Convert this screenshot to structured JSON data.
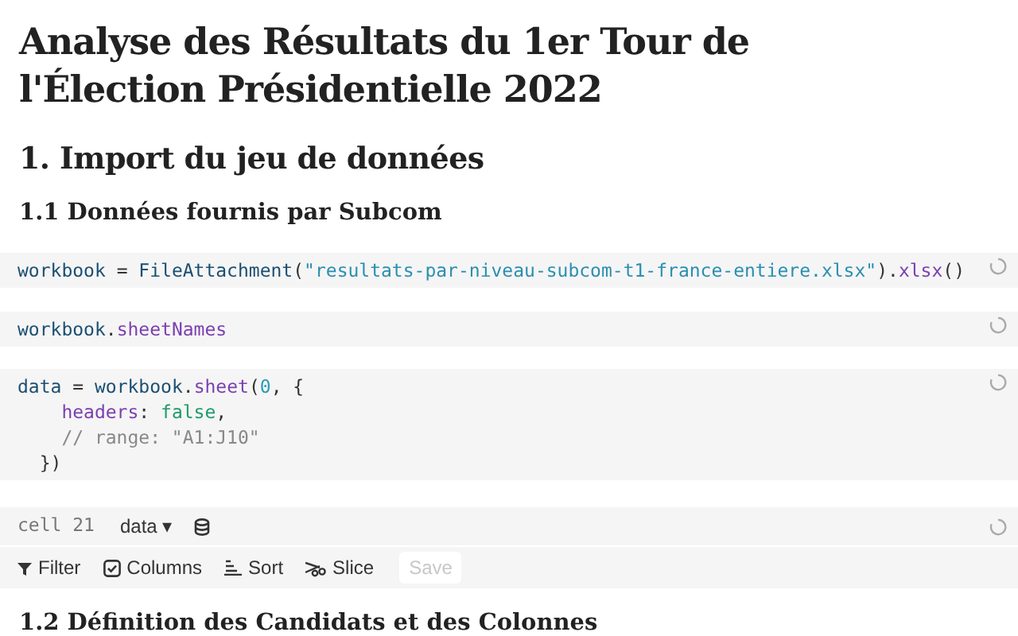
{
  "title": "Analyse des Résultats du 1er Tour de l'Élection Présidentielle 2022",
  "heading_1": "1. Import du jeu de données",
  "heading_2": "1.1 Données fournis par Subcom",
  "cells": [
    {
      "lines": [
        [
          {
            "t": "workbook",
            "kind": "var"
          },
          {
            "t": " = ",
            "kind": "op"
          },
          {
            "t": "FileAttachment",
            "kind": "var"
          },
          {
            "t": "(",
            "kind": "op"
          },
          {
            "t": "\"resultats-par-niveau-subcom-t1-france-entiere.xlsx\"",
            "kind": "str"
          },
          {
            "t": ").",
            "kind": "op"
          },
          {
            "t": "xlsx",
            "kind": "prop"
          },
          {
            "t": "()",
            "kind": "op"
          }
        ]
      ]
    },
    {
      "lines": [
        [
          {
            "t": "workbook",
            "kind": "var"
          },
          {
            "t": ".",
            "kind": "op"
          },
          {
            "t": "sheetNames",
            "kind": "prop"
          }
        ]
      ]
    },
    {
      "lines": [
        [
          {
            "t": "data",
            "kind": "var"
          },
          {
            "t": " = ",
            "kind": "op"
          },
          {
            "t": "workbook",
            "kind": "var"
          },
          {
            "t": ".",
            "kind": "op"
          },
          {
            "t": "sheet",
            "kind": "prop"
          },
          {
            "t": "(",
            "kind": "op"
          },
          {
            "t": "0",
            "kind": "num"
          },
          {
            "t": ", {",
            "kind": "op"
          }
        ],
        [
          {
            "t": "    headers",
            "kind": "prop"
          },
          {
            "t": ": ",
            "kind": "op"
          },
          {
            "t": "false",
            "kind": "bool"
          },
          {
            "t": ",",
            "kind": "op"
          }
        ],
        [
          {
            "t": "    // range: \"A1:J10\"",
            "kind": "comment"
          }
        ],
        [
          {
            "t": "  })",
            "kind": "op"
          }
        ]
      ]
    }
  ],
  "data_cell": {
    "label": "cell 21",
    "name": "data ▾",
    "toolbar": [
      {
        "label": "Filter",
        "kind": "filter"
      },
      {
        "label": "Columns",
        "kind": "columns"
      },
      {
        "label": "Sort",
        "kind": "sort"
      },
      {
        "label": "Slice",
        "kind": "slice"
      },
      {
        "label": "Save",
        "kind": "save",
        "disabled": true
      }
    ]
  },
  "heading_3": "1.2 Définition des Candidats et des Colonnes"
}
